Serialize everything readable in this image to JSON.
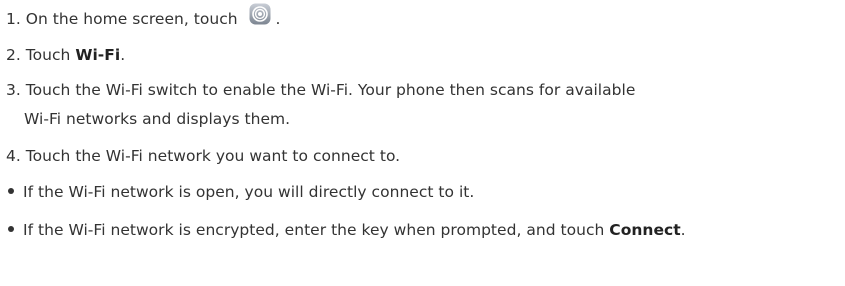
{
  "steps": [
    {
      "number": "1.",
      "text_before": "On the home screen, touch",
      "icon": "settings-icon",
      "text_after": "."
    },
    {
      "number": "2.",
      "text_before": "Touch ",
      "bold": "Wi-Fi",
      "text_after": "."
    },
    {
      "number": "3.",
      "line1": "Touch the Wi-Fi switch to enable the Wi-Fi. Your phone then scans for available",
      "line2": "Wi-Fi networks and displays them."
    },
    {
      "number": "4.",
      "text": "Touch the Wi-Fi network you want to connect to."
    }
  ],
  "bullets": [
    {
      "text": "If the Wi-Fi network is open, you will directly connect to it."
    },
    {
      "text_before": "If the Wi-Fi network is encrypted, enter the key when prompted, and touch ",
      "bold": "Connect",
      "text_after": "."
    }
  ]
}
